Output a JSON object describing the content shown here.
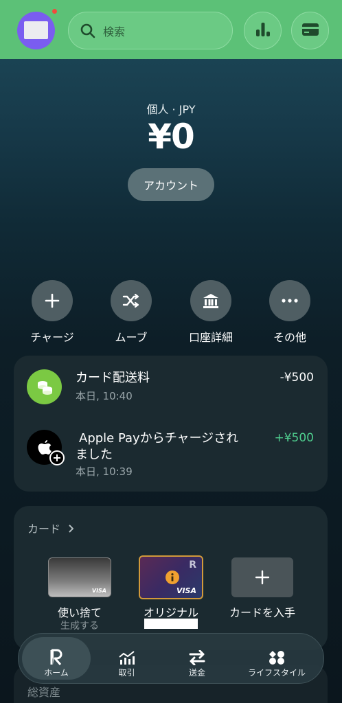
{
  "header": {
    "search_placeholder": "検索",
    "stats_icon": "bar-chart-icon",
    "cards_icon": "card-icon"
  },
  "account": {
    "label": "個人 · JPY",
    "balance": "¥0",
    "button_label": "アカウント"
  },
  "actions": [
    {
      "label": "チャージ",
      "icon": "plus-icon"
    },
    {
      "label": "ムーブ",
      "icon": "shuffle-icon"
    },
    {
      "label": "口座詳細",
      "icon": "bank-icon"
    },
    {
      "label": "その他",
      "icon": "more-icon"
    }
  ],
  "transactions": [
    {
      "title": "カード配送料",
      "time": "本日, 10:40",
      "amount": "-¥500",
      "icon": "coins-icon",
      "color": "#7bc943"
    },
    {
      "title": "Apple Payからチャージされ",
      "title2": "ました",
      "time": "本日, 10:39",
      "amount": "+¥500",
      "icon": "apple-icon",
      "color": "#4fcf8f"
    }
  ],
  "cards": {
    "heading": "カード",
    "items": [
      {
        "label": "使い捨て",
        "sub": "生成する",
        "brand": "VISA"
      },
      {
        "label": "オリジナル",
        "brand": "VISA"
      },
      {
        "label": "カードを入手"
      }
    ]
  },
  "peek": {
    "title": "総資産"
  },
  "nav": [
    {
      "label": "ホーム",
      "icon": "revolut-logo-icon"
    },
    {
      "label": "取引",
      "icon": "chart-icon"
    },
    {
      "label": "送金",
      "icon": "transfer-icon"
    },
    {
      "label": "ライフスタイル",
      "icon": "lifestyle-icon"
    }
  ],
  "colors": {
    "topbar": "#5cc177",
    "accent": "#7a5df0",
    "positive": "#4fcf8f"
  }
}
